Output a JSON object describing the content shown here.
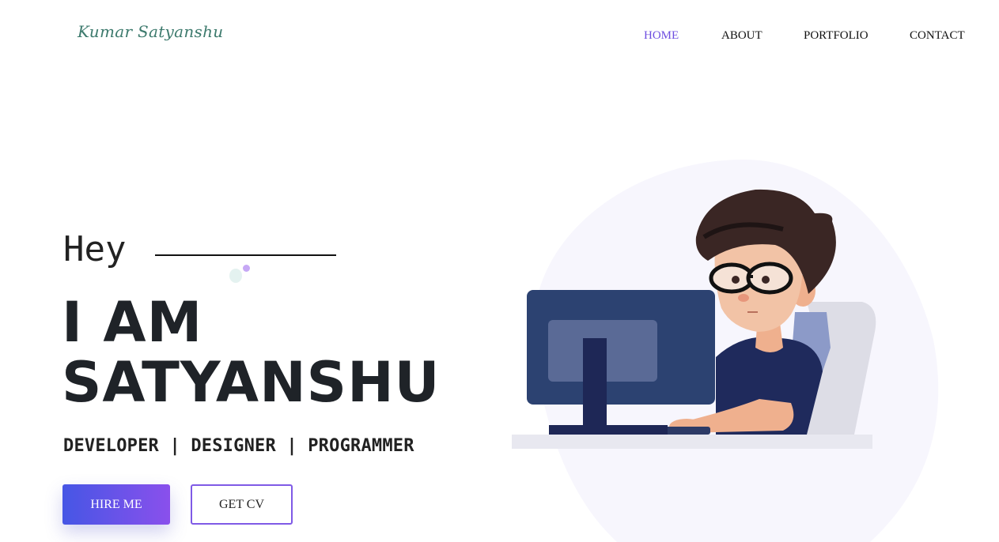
{
  "logo": {
    "text": "Kumar Satyanshu"
  },
  "nav": {
    "items": [
      {
        "label": "HOME",
        "active": true
      },
      {
        "label": "ABOUT",
        "active": false
      },
      {
        "label": "PORTFOLIO",
        "active": false
      },
      {
        "label": "CONTACT",
        "active": false
      }
    ]
  },
  "hero": {
    "greeting": "Hey",
    "headline_line1": "I AM",
    "headline_line2": "SATYANSHU",
    "roles": "DEVELOPER | DESIGNER | PROGRAMMER",
    "hire_label": "HIRE ME",
    "cv_label": "GET CV",
    "illustration": "developer-at-computer-illustration"
  },
  "colors": {
    "accent": "#6d4de0",
    "logo": "#3d7a6d",
    "button_gradient_start": "#4656e5",
    "button_gradient_end": "#8a50ec",
    "blob": "#f7f6fd"
  }
}
